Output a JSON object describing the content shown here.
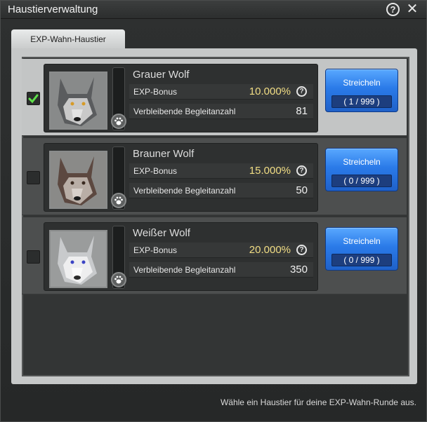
{
  "window": {
    "title": "Haustierverwaltung",
    "help_icon": "help-circle-icon",
    "close_icon": "close-icon",
    "help_glyph": "?",
    "close_glyph": "✕"
  },
  "tabs": [
    {
      "label": "EXP-Wahn-Haustier",
      "active": true
    }
  ],
  "pets": [
    {
      "name": "Grauer Wolf",
      "selected": true,
      "bonus_label": "EXP-Bonus",
      "bonus_value": "10.000%",
      "remaining_label": "Verbleibende Begleitanzahl",
      "remaining_value": "81",
      "button_label": "Streicheln",
      "button_count": "( 1 / 999 )"
    },
    {
      "name": "Brauner Wolf",
      "selected": false,
      "bonus_label": "EXP-Bonus",
      "bonus_value": "15.000%",
      "remaining_label": "Verbleibende Begleitanzahl",
      "remaining_value": "50",
      "button_label": "Streicheln",
      "button_count": "( 0 / 999 )"
    },
    {
      "name": "Weißer Wolf",
      "selected": false,
      "bonus_label": "EXP-Bonus",
      "bonus_value": "20.000%",
      "remaining_label": "Verbleibende Begleitanzahl",
      "remaining_value": "350",
      "button_label": "Streicheln",
      "button_count": "( 0 / 999 )"
    }
  ],
  "info_glyph": "?",
  "footer_text": "Wähle ein Haustier für deine EXP-Wahn-Runde aus.",
  "colors": {
    "button_blue": "#2a7ae8",
    "bonus_gold": "#f1dd84",
    "check_green": "#5fe04a"
  }
}
